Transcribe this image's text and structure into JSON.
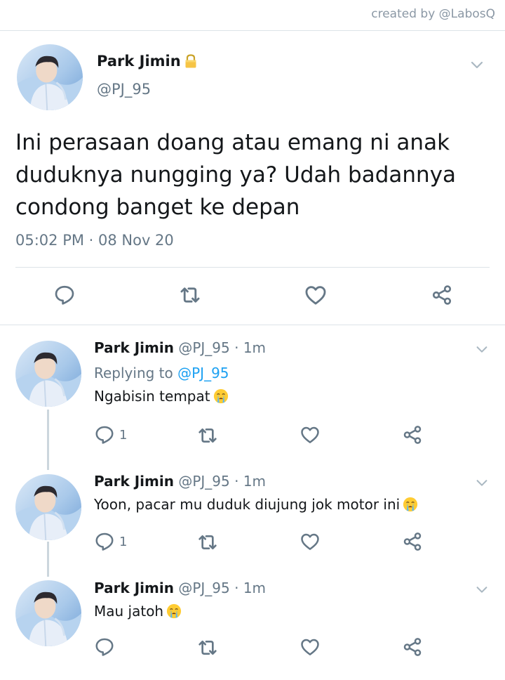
{
  "credit": "created by @LabosQ",
  "main_tweet": {
    "name": "Park Jimin",
    "handle": "@PJ_95",
    "locked_icon": "lock-icon",
    "text": "Ini perasaan doang atau emang ni anak duduknya nungging ya? Udah badannya condong banget ke depan",
    "time": "05:02 PM · 08 Nov 20"
  },
  "replies": [
    {
      "name": "Park Jimin",
      "handle": "@PJ_95 · 1m",
      "replying_prefix": "Replying to",
      "replying_to": "@PJ_95",
      "text": "Ngabisin tempat",
      "emoji": "crying-face-emoji",
      "reply_count": "1"
    },
    {
      "name": "Park Jimin",
      "handle": "@PJ_95 · 1m",
      "text": "Yoon, pacar mu duduk diujung jok motor ini",
      "emoji": "crying-face-emoji",
      "reply_count": "1"
    },
    {
      "name": "Park Jimin",
      "handle": "@PJ_95 · 1m",
      "text": "Mau jatoh",
      "emoji": "crying-face-emoji",
      "reply_count": ""
    }
  ],
  "colors": {
    "text": "#14171a",
    "secondary": "#657786",
    "link": "#1da1f2",
    "icon": "#657786",
    "divider": "#dde3e8"
  }
}
